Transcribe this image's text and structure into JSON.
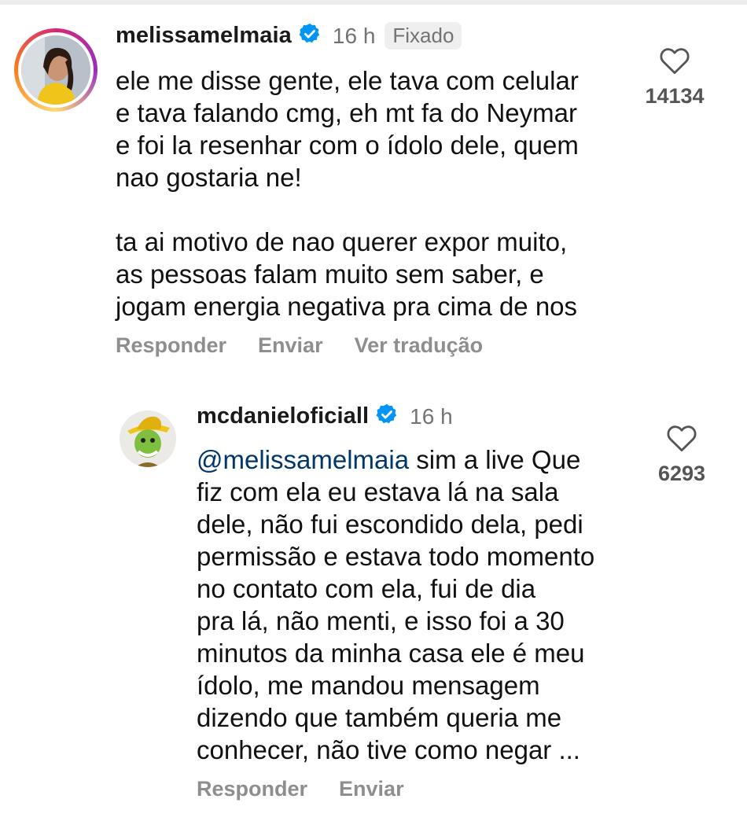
{
  "comments": [
    {
      "username": "melissamelmaia",
      "time": "16 h",
      "pinned_label": "Fixado",
      "text": "ele me disse gente, ele tava com celular\ne tava falando cmg, eh mt fa do Neymar\ne foi la resenhar com o ídolo dele, quem\nnao gostaria ne!\n\nta ai motivo de nao querer expor muito,\nas pessoas falam muito sem saber, e\njogam energia negativa pra cima de nos",
      "like_count": "14134",
      "actions": [
        "Responder",
        "Enviar",
        "Ver tradução"
      ],
      "avatar": "user-photo",
      "ring_colors": [
        "#feda75",
        "#fa7e1e",
        "#d62976",
        "#962fbf"
      ]
    },
    {
      "username": "mcdanieloficiall",
      "time": "16 h",
      "mention": "@melissamelmaia",
      "text": " sim a live Que\nfiz com ela eu estava lá na sala\ndele, não fui escondido dela, pedi\npermissão e estava todo momento\nno contato com ela, fui de dia\npra lá, não menti, e isso foi a 30\nminutos da minha casa ele é meu\nídolo, me mandou mensagem\ndizendo que também queria me\nconhecer, não tive como negar ...",
      "like_count": "6293",
      "actions": [
        "Responder",
        "Enviar"
      ],
      "avatar": "mask-character-photo"
    }
  ],
  "colors": {
    "verified": "#0095f6",
    "mention": "#00376b",
    "muted": "#737373"
  },
  "icons": [
    "verified-badge-icon",
    "heart-outline-icon"
  ]
}
